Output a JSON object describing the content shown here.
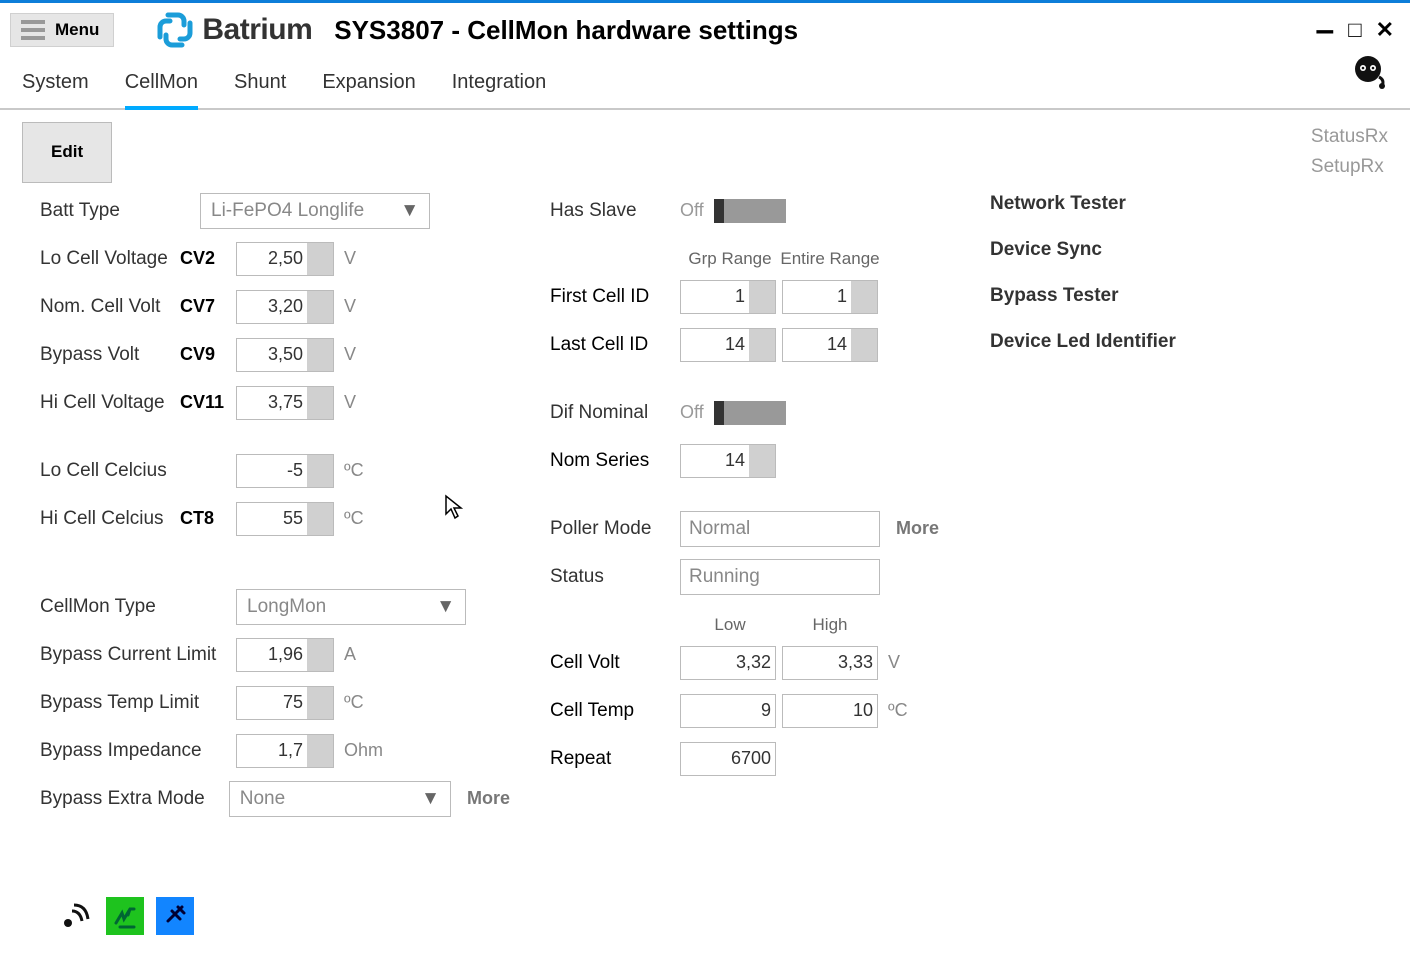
{
  "menu_label": "Menu",
  "brand": "Batrium",
  "page_title": "SYS3807 - CellMon hardware settings",
  "tabs": [
    "System",
    "CellMon",
    "Shunt",
    "Expansion",
    "Integration"
  ],
  "active_tab": "CellMon",
  "edit_button": "Edit",
  "status_links": [
    "StatusRx",
    "SetupRx"
  ],
  "side_links": [
    "Network Tester",
    "Device Sync",
    "Bypass Tester",
    "Device Led Identifier"
  ],
  "col1": {
    "batt_type_label": "Batt Type",
    "batt_type_value": "Li-FePO4 Longlife",
    "lo_cell_voltage_label": "Lo Cell Voltage",
    "lo_cell_voltage_code": "CV2",
    "lo_cell_voltage_value": "2,50",
    "nom_cell_volt_label": "Nom. Cell Volt",
    "nom_cell_volt_code": "CV7",
    "nom_cell_volt_value": "3,20",
    "bypass_volt_label": "Bypass Volt",
    "bypass_volt_code": "CV9",
    "bypass_volt_value": "3,50",
    "hi_cell_voltage_label": "Hi Cell Voltage",
    "hi_cell_voltage_code": "CV11",
    "hi_cell_voltage_value": "3,75",
    "volt_unit": "V",
    "lo_cell_celcius_label": "Lo Cell Celcius",
    "lo_cell_celcius_value": "-5",
    "hi_cell_celcius_label": "Hi Cell Celcius",
    "hi_cell_celcius_code": "CT8",
    "hi_cell_celcius_value": "55",
    "temp_unit": "ºC",
    "cellmon_type_label": "CellMon Type",
    "cellmon_type_value": "LongMon",
    "bypass_current_limit_label": "Bypass Current Limit",
    "bypass_current_limit_value": "1,96",
    "amp_unit": "A",
    "bypass_temp_limit_label": "Bypass Temp Limit",
    "bypass_temp_limit_value": "75",
    "bypass_impedance_label": "Bypass Impedance",
    "bypass_impedance_value": "1,7",
    "ohm_unit": "Ohm",
    "bypass_extra_mode_label": "Bypass Extra Mode",
    "bypass_extra_mode_value": "None",
    "more_label": "More"
  },
  "col2": {
    "has_slave_label": "Has Slave",
    "off_label": "Off",
    "grp_range_label": "Grp Range",
    "entire_range_label": "Entire Range",
    "first_cell_id_label": "First Cell ID",
    "first_cell_id_grp": "1",
    "first_cell_id_entire": "1",
    "last_cell_id_label": "Last Cell ID",
    "last_cell_id_grp": "14",
    "last_cell_id_entire": "14",
    "dif_nominal_label": "Dif Nominal",
    "nom_series_label": "Nom Series",
    "nom_series_value": "14",
    "poller_mode_label": "Poller Mode",
    "poller_mode_value": "Normal",
    "more_label": "More",
    "status_label": "Status",
    "status_value": "Running",
    "low_label": "Low",
    "high_label": "High",
    "cell_volt_label": "Cell Volt",
    "cell_volt_low": "3,32",
    "cell_volt_high": "3,33",
    "volt_unit": "V",
    "cell_temp_label": "Cell Temp",
    "cell_temp_low": "9",
    "cell_temp_high": "10",
    "temp_unit": "ºC",
    "repeat_label": "Repeat",
    "repeat_value": "6700"
  }
}
